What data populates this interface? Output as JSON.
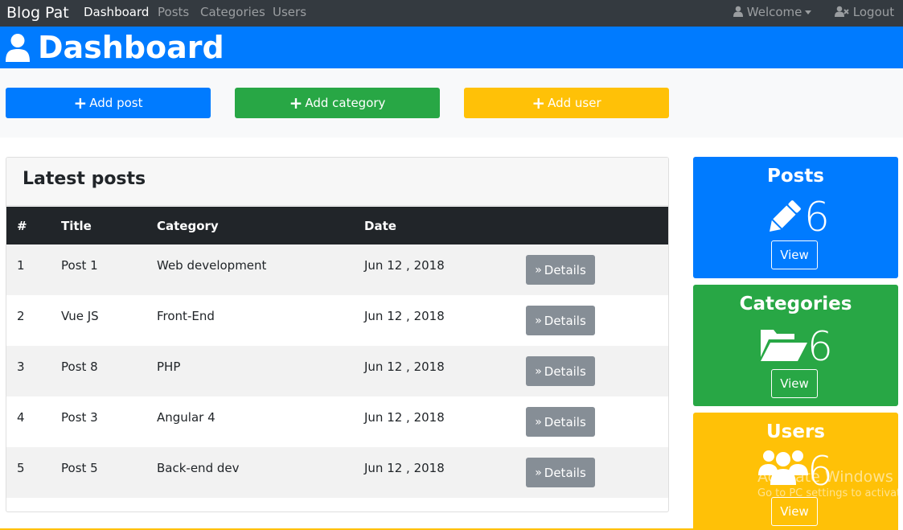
{
  "navbar": {
    "brand": "Blog Pat",
    "links": [
      "Dashboard",
      "Posts",
      "Categories",
      "Users"
    ],
    "welcome": "Welcome",
    "logout": "Logout"
  },
  "header": {
    "title": "Dashboard"
  },
  "actions": {
    "add_post": "Add post",
    "add_category": "Add category",
    "add_user": "Add user"
  },
  "posts_table": {
    "title": "Latest posts",
    "columns": [
      "#",
      "Title",
      "Category",
      "Date"
    ],
    "rows": [
      {
        "num": "1",
        "title": "Post 1",
        "category": "Web development",
        "date": "Jun 12 , 2018"
      },
      {
        "num": "2",
        "title": "Vue JS",
        "category": "Front-End",
        "date": "Jun 12 , 2018"
      },
      {
        "num": "3",
        "title": "Post 8",
        "category": "PHP",
        "date": "Jun 12 , 2018"
      },
      {
        "num": "4",
        "title": "Post 3",
        "category": "Angular 4",
        "date": "Jun 12 , 2018"
      },
      {
        "num": "5",
        "title": "Post 5",
        "category": "Back-end dev",
        "date": "Jun 12 , 2018"
      }
    ],
    "details_label": "Details"
  },
  "stats": {
    "posts": {
      "title": "Posts",
      "count": "6",
      "view": "View"
    },
    "categories": {
      "title": "Categories",
      "count": "6",
      "view": "View"
    },
    "users": {
      "title": "Users",
      "count": "6",
      "view": "View"
    }
  },
  "watermark": {
    "line1": "Activate Windows",
    "line2": "Go to PC settings to activate"
  },
  "colors": {
    "navbar": "#343a40",
    "primary": "#007bff",
    "success": "#28a745",
    "warning": "#ffc107",
    "secondary": "#868e96"
  }
}
